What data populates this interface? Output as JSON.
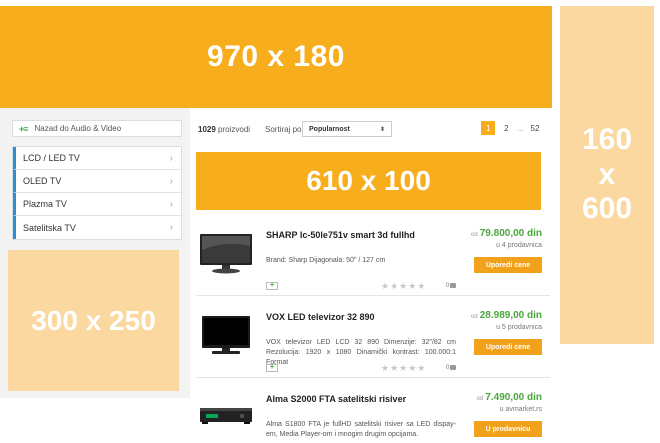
{
  "ads": {
    "top": "970 x 180",
    "side": "160\nx\n600",
    "middle": "610 x 100",
    "left": "300 x 250"
  },
  "colors": {
    "ad_primary": "#f8ad1c",
    "ad_light": "#fbd8a0",
    "price": "#4aa63c",
    "button": "#f2a11a",
    "category_accent": "#2a8ed8"
  },
  "sidebar": {
    "back_label": "Nazad do Audio & Video",
    "categories": [
      {
        "label": "LCD / LED TV"
      },
      {
        "label": "OLED TV"
      },
      {
        "label": "Plazma TV"
      },
      {
        "label": "Satelitska TV"
      }
    ]
  },
  "toolbar": {
    "count": "1029",
    "count_label": "proizvodi",
    "sort_label": "Sortiraj po:",
    "sort_value": "Popularnost",
    "pages": [
      "1",
      "2",
      "...",
      "52"
    ]
  },
  "products": [
    {
      "title": "SHARP lc-50le751v smart 3d fullhd",
      "desc": "Brand: Sharp Dijagonala: 50\" / 127 cm",
      "price_prefix": "od",
      "price": "79.800,00 din",
      "stores": "u 4 prodavnica",
      "button": "Uporedi cene",
      "reviews": "0"
    },
    {
      "title": "VOX LED televizor 32 890",
      "desc": "VOX televizor LED LCD 32 890 Dimenzije: 32\"/82 cm Rezolucija: 1920 x 1080 Dinamički kontrast: 100.000:1 Format",
      "price_prefix": "od",
      "price": "28.989,00 din",
      "stores": "u 5 prodavnica",
      "button": "Uporedi cene",
      "reviews": "0"
    },
    {
      "title": "Alma S2000 FTA satelitski risiver",
      "desc": "Alma S1800 FTA je fullHD satelitski risiver sa LED dispay-em, Media Player-om i mnogim drugim opcijama.",
      "price_prefix": "od",
      "price": "7.490,00 din",
      "stores": "u avmarket.rs",
      "button": "U prodavnicu",
      "reviews": ""
    }
  ]
}
